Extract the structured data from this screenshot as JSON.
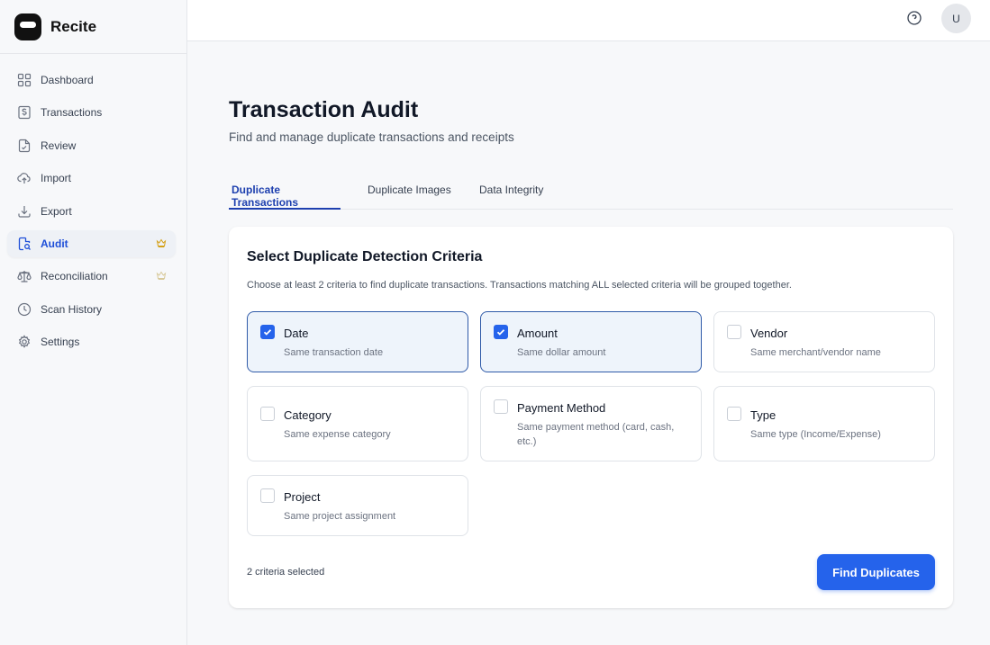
{
  "app": {
    "name": "Recite"
  },
  "sidebar": {
    "items": [
      {
        "label": "Dashboard",
        "icon": "dashboard-icon"
      },
      {
        "label": "Transactions",
        "icon": "dollar-icon"
      },
      {
        "label": "Review",
        "icon": "review-icon"
      },
      {
        "label": "Import",
        "icon": "upload-cloud-icon"
      },
      {
        "label": "Export",
        "icon": "download-icon"
      },
      {
        "label": "Audit",
        "icon": "audit-icon",
        "active": true,
        "badge": "crown-icon"
      },
      {
        "label": "Reconciliation",
        "icon": "scale-icon",
        "badge": "crown-icon"
      },
      {
        "label": "Scan History",
        "icon": "clock-icon"
      },
      {
        "label": "Settings",
        "icon": "gear-icon"
      }
    ]
  },
  "topbar": {
    "avatar_initial": "U",
    "help_icon": "help-circle-icon"
  },
  "page": {
    "title": "Transaction Audit",
    "subtitle": "Find and manage duplicate transactions and receipts"
  },
  "tabs": [
    {
      "label": "Duplicate Transactions",
      "active": true
    },
    {
      "label": "Duplicate Images"
    },
    {
      "label": "Data Integrity"
    }
  ],
  "criteria": {
    "title": "Select Duplicate Detection Criteria",
    "description": "Choose at least 2 criteria to find duplicate transactions. Transactions matching ALL selected criteria will be grouped together.",
    "options": [
      {
        "label": "Date",
        "desc": "Same transaction date",
        "checked": true
      },
      {
        "label": "Amount",
        "desc": "Same dollar amount",
        "checked": true
      },
      {
        "label": "Vendor",
        "desc": "Same merchant/vendor name",
        "checked": false
      },
      {
        "label": "Category",
        "desc": "Same expense category",
        "checked": false
      },
      {
        "label": "Payment Method",
        "desc": "Same payment method (card, cash, etc.)",
        "checked": false
      },
      {
        "label": "Type",
        "desc": "Same type (Income/Expense)",
        "checked": false
      },
      {
        "label": "Project",
        "desc": "Same project assignment",
        "checked": false
      }
    ],
    "selected_count_text": "2 criteria selected",
    "find_button": "Find Duplicates"
  },
  "colors": {
    "accent": "#2563eb",
    "active_nav_text": "#1d4ed8",
    "crown": "#d4a017"
  }
}
